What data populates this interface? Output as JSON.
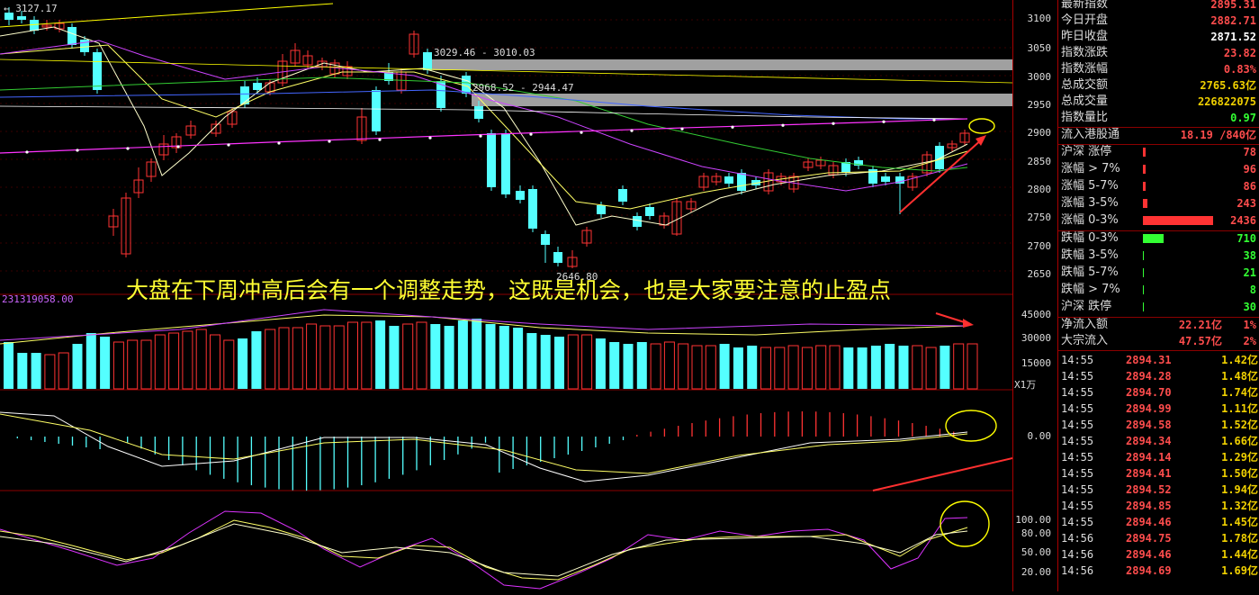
{
  "main_chart": {
    "top_price_label": "3127.17",
    "low_price_label": "2646.80",
    "box1_label": "3029.46 - 3010.03",
    "box2_label": "2968.52 - 2944.47",
    "volume_label": "231319058.00",
    "volume_unit": "X1万",
    "annotation": "大盘在下周冲高后会有一个调整走势，这既是机会，也是大家要注意的止盈点"
  },
  "price_axis": [
    "3100",
    "3050",
    "3000",
    "2950",
    "2900",
    "2850",
    "2800",
    "2750",
    "2700",
    "2650"
  ],
  "volume_axis": [
    "45000",
    "30000",
    "15000"
  ],
  "macd_axis": [
    "0.00"
  ],
  "kdj_axis": [
    "100.00",
    "80.00",
    "50.00",
    "20.00"
  ],
  "colors": {
    "up": "#ff3333",
    "down": "#54ffff",
    "text_yellow": "#f0d000",
    "green": "#33ff33"
  },
  "stats": [
    {
      "label": "最新指数",
      "value": "2895.31",
      "color": "#ff4d4d"
    },
    {
      "label": "今日开盘",
      "value": "2882.71",
      "color": "#ff4d4d"
    },
    {
      "label": "昨日收盘",
      "value": "2871.52",
      "color": "#ffffff"
    },
    {
      "label": "指数涨跌",
      "value": "23.82",
      "color": "#ff4d4d"
    },
    {
      "label": "指数涨幅",
      "value": "0.83%",
      "color": "#ff4d4d"
    },
    {
      "label": "总成交额",
      "value": "2765.63亿",
      "color": "#f0d000"
    },
    {
      "label": "总成交量",
      "value": "226822075",
      "color": "#f0d000"
    },
    {
      "label": "指数量比",
      "value": "0.97",
      "color": "#33ff33"
    }
  ],
  "hk_flow": {
    "label": "流入港股通",
    "value": "18.19 /840亿"
  },
  "up_dist": [
    {
      "label": "沪深 涨停",
      "count": "78",
      "fill": 0.01
    },
    {
      "label": "涨幅 > 7%",
      "count": "96",
      "fill": 0.01
    },
    {
      "label": "涨幅 5-7%",
      "count": "86",
      "fill": 0.01
    },
    {
      "label": "涨幅 3-5%",
      "count": "243",
      "fill": 0.06
    },
    {
      "label": "涨幅 0-3%",
      "count": "2436",
      "fill": 1.0
    }
  ],
  "down_dist": [
    {
      "label": "跌幅 0-3%",
      "count": "710",
      "fill": 0.29
    },
    {
      "label": "跌幅 3-5%",
      "count": "38",
      "fill": 0.005
    },
    {
      "label": "跌幅 5-7%",
      "count": "21",
      "fill": 0.005
    },
    {
      "label": "跌幅 > 7%",
      "count": "8",
      "fill": 0.005
    },
    {
      "label": "沪深 跌停",
      "count": "30",
      "fill": 0.005
    }
  ],
  "flows": [
    {
      "label": "净流入额",
      "value": "22.21亿",
      "pct": "1%"
    },
    {
      "label": "大宗流入",
      "value": "47.57亿",
      "pct": "2%"
    }
  ],
  "ticks": [
    {
      "time": "14:55",
      "price": "2894.31",
      "vol": "1.42亿"
    },
    {
      "time": "14:55",
      "price": "2894.28",
      "vol": "1.48亿"
    },
    {
      "time": "14:55",
      "price": "2894.70",
      "vol": "1.74亿"
    },
    {
      "time": "14:55",
      "price": "2894.99",
      "vol": "1.11亿"
    },
    {
      "time": "14:55",
      "price": "2894.58",
      "vol": "1.52亿"
    },
    {
      "time": "14:55",
      "price": "2894.34",
      "vol": "1.66亿"
    },
    {
      "time": "14:55",
      "price": "2894.14",
      "vol": "1.29亿"
    },
    {
      "time": "14:55",
      "price": "2894.41",
      "vol": "1.50亿"
    },
    {
      "time": "14:55",
      "price": "2894.52",
      "vol": "1.94亿"
    },
    {
      "time": "14:55",
      "price": "2894.85",
      "vol": "1.32亿"
    },
    {
      "time": "14:55",
      "price": "2894.46",
      "vol": "1.45亿"
    },
    {
      "time": "14:56",
      "price": "2894.75",
      "vol": "1.78亿"
    },
    {
      "time": "14:56",
      "price": "2894.46",
      "vol": "1.44亿"
    },
    {
      "time": "14:56",
      "price": "2894.69",
      "vol": "1.69亿"
    }
  ]
}
